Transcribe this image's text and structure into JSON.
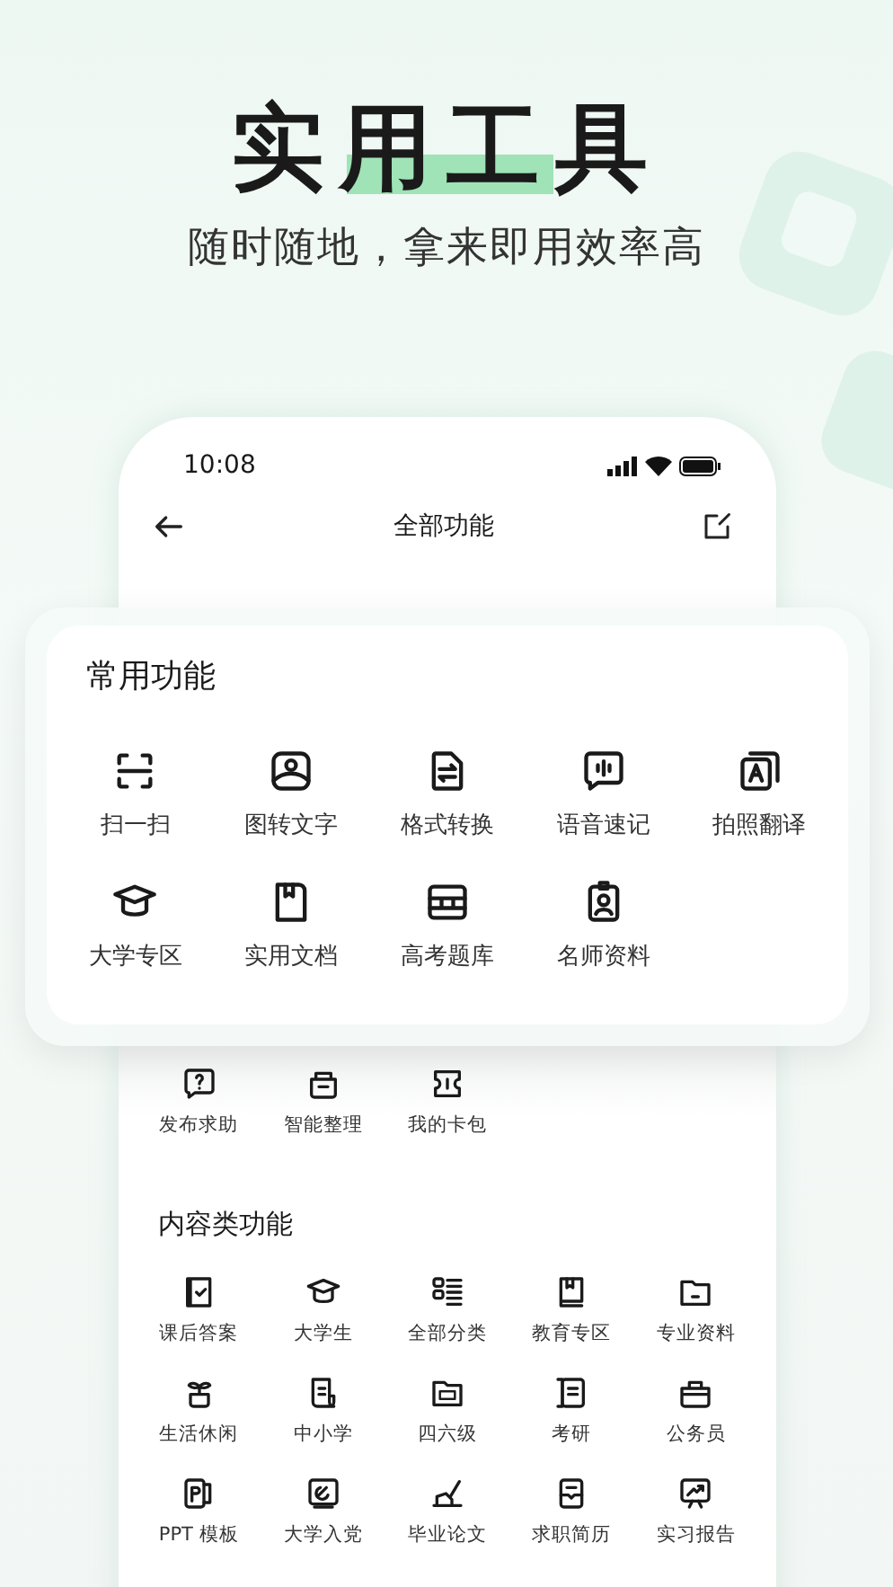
{
  "headline": {
    "title": "实用工具",
    "subtitle": "随时随地，拿来即用效率高"
  },
  "status_bar": {
    "time": "10:08"
  },
  "nav": {
    "title": "全部功能"
  },
  "common": {
    "title": "常用功能",
    "items": [
      {
        "label": "扫一扫"
      },
      {
        "label": "图转文字"
      },
      {
        "label": "格式转换"
      },
      {
        "label": "语音速记"
      },
      {
        "label": "拍照翻译"
      },
      {
        "label": "大学专区"
      },
      {
        "label": "实用文档"
      },
      {
        "label": "高考题库"
      },
      {
        "label": "名师资料"
      }
    ]
  },
  "more_tools": [
    {
      "label": "发布求助"
    },
    {
      "label": "智能整理"
    },
    {
      "label": "我的卡包"
    }
  ],
  "content": {
    "title": "内容类功能",
    "items": [
      {
        "label": "课后答案"
      },
      {
        "label": "大学生"
      },
      {
        "label": "全部分类"
      },
      {
        "label": "教育专区"
      },
      {
        "label": "专业资料"
      },
      {
        "label": "生活休闲"
      },
      {
        "label": "中小学"
      },
      {
        "label": "四六级"
      },
      {
        "label": "考研"
      },
      {
        "label": "公务员"
      },
      {
        "label": "PPT 模板"
      },
      {
        "label": "大学入党"
      },
      {
        "label": "毕业论文"
      },
      {
        "label": "求职简历"
      },
      {
        "label": "实习报告"
      }
    ]
  }
}
